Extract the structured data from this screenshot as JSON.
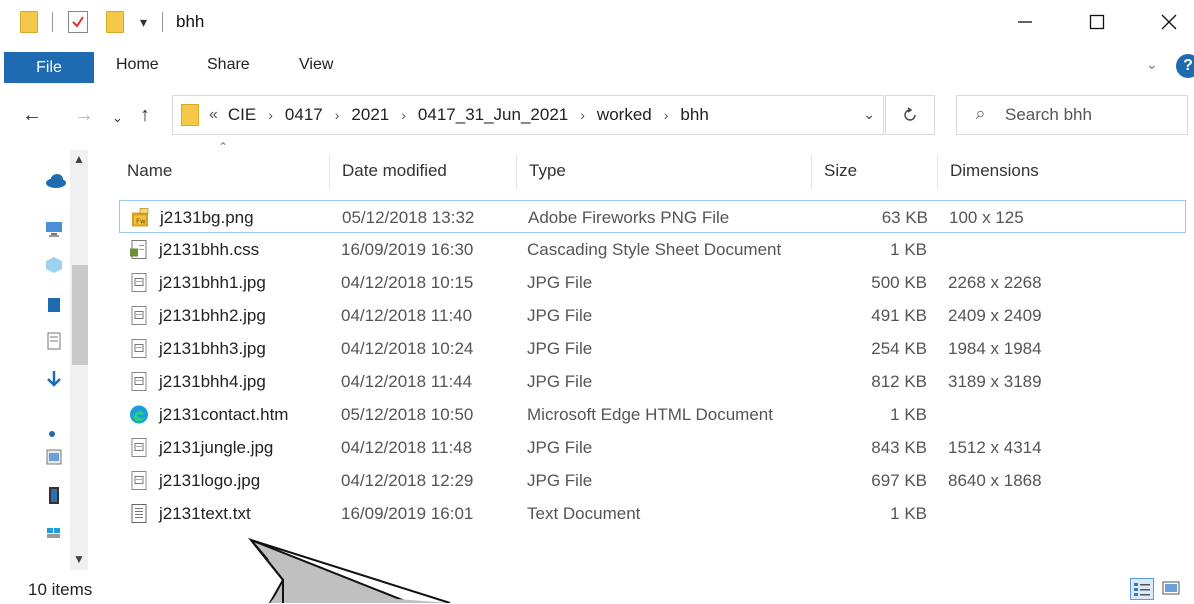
{
  "window": {
    "title": "bhh",
    "minimize_icon": "minimize-icon",
    "maximize_icon": "maximize-icon",
    "close_icon": "close-icon"
  },
  "quick_access": {
    "dropdown_glyph": "▾"
  },
  "ribbon": {
    "tabs": [
      {
        "label": "File"
      },
      {
        "label": "Home"
      },
      {
        "label": "Share"
      },
      {
        "label": "View"
      }
    ],
    "help": "?",
    "accent": "#1f6bb1"
  },
  "address": {
    "overflow": "«",
    "crumbs": [
      "CIE",
      "0417",
      "2021",
      "0417_31_Jun_2021",
      "worked",
      "bhh"
    ]
  },
  "search": {
    "placeholder": "Search bhh"
  },
  "columns": {
    "name": "Name",
    "date": "Date modified",
    "type": "Type",
    "size": "Size",
    "dimensions": "Dimensions"
  },
  "files": [
    {
      "name": "j2131bg.png",
      "date": "05/12/2018 13:32",
      "type": "Adobe Fireworks PNG File",
      "size": "63 KB",
      "dimensions": "100 x 125",
      "icon": "fireworks-png-icon",
      "selected": true
    },
    {
      "name": "j2131bhh.css",
      "date": "16/09/2019 16:30",
      "type": "Cascading Style Sheet Document",
      "size": "1 KB",
      "dimensions": "",
      "icon": "css-file-icon"
    },
    {
      "name": "j2131bhh1.jpg",
      "date": "04/12/2018 10:15",
      "type": "JPG File",
      "size": "500 KB",
      "dimensions": "2268 x 2268",
      "icon": "jpg-file-icon"
    },
    {
      "name": "j2131bhh2.jpg",
      "date": "04/12/2018 11:40",
      "type": "JPG File",
      "size": "491 KB",
      "dimensions": "2409 x 2409",
      "icon": "jpg-file-icon"
    },
    {
      "name": "j2131bhh3.jpg",
      "date": "04/12/2018 10:24",
      "type": "JPG File",
      "size": "254 KB",
      "dimensions": "1984 x 1984",
      "icon": "jpg-file-icon"
    },
    {
      "name": "j2131bhh4.jpg",
      "date": "04/12/2018 11:44",
      "type": "JPG File",
      "size": "812 KB",
      "dimensions": "3189 x 3189",
      "icon": "jpg-file-icon"
    },
    {
      "name": "j2131contact.htm",
      "date": "05/12/2018 10:50",
      "type": "Microsoft Edge HTML Document",
      "size": "1 KB",
      "dimensions": "",
      "icon": "edge-html-icon"
    },
    {
      "name": "j2131jungle.jpg",
      "date": "04/12/2018 11:48",
      "type": "JPG File",
      "size": "843 KB",
      "dimensions": "1512 x 4314",
      "icon": "jpg-file-icon"
    },
    {
      "name": "j2131logo.jpg",
      "date": "04/12/2018 12:29",
      "type": "JPG File",
      "size": "697 KB",
      "dimensions": "8640 x 1868",
      "icon": "jpg-file-icon"
    },
    {
      "name": "j2131text.txt",
      "date": "16/09/2019 16:01",
      "type": "Text Document",
      "size": "1 KB",
      "dimensions": "",
      "icon": "text-file-icon"
    }
  ],
  "status": {
    "item_count": "10 items"
  }
}
